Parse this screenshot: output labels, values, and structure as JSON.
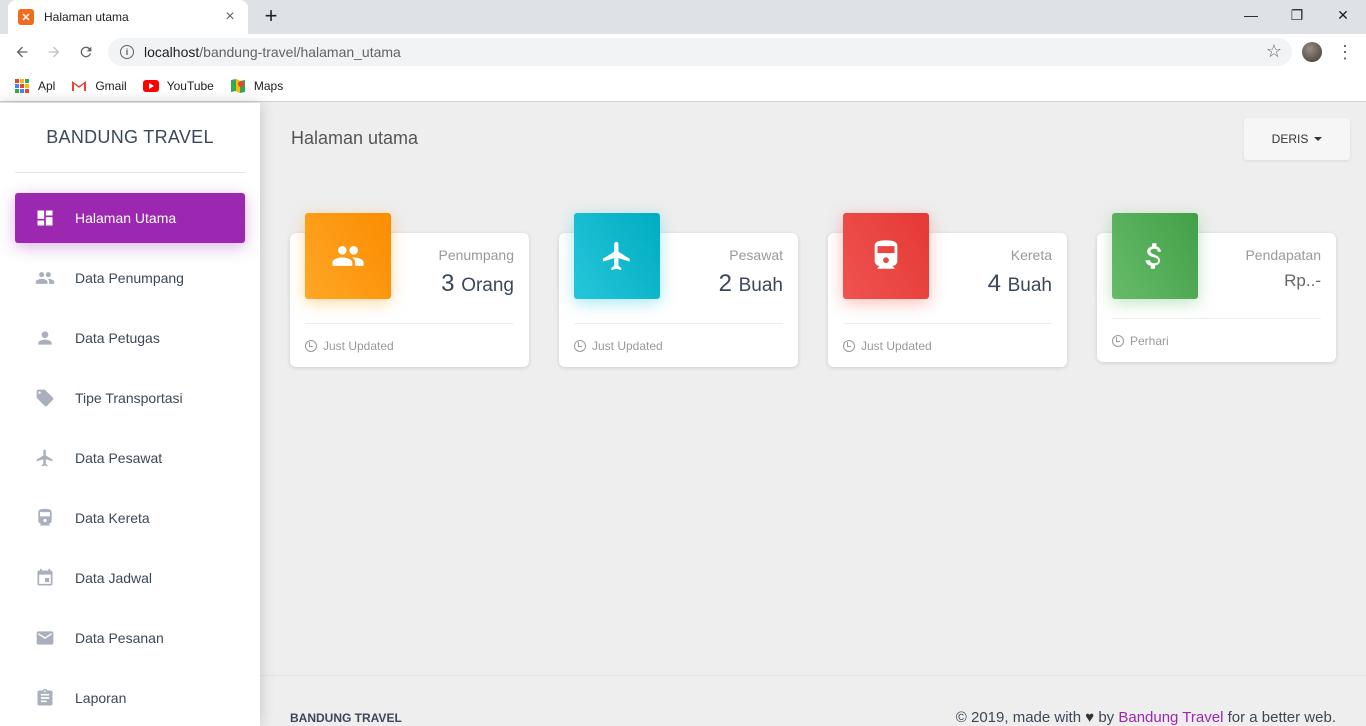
{
  "browser": {
    "tab_title": "Halaman utama",
    "tab_close": "×",
    "new_tab": "+",
    "url_host": "localhost",
    "url_path": "/bandung-travel/halaman_utama",
    "window_controls": {
      "minimize": "—",
      "maximize": "❐",
      "close": "✕"
    },
    "bookmarks": [
      {
        "label": "Apl",
        "icon": "apps-grid-icon"
      },
      {
        "label": "Gmail",
        "icon": "gmail-icon"
      },
      {
        "label": "YouTube",
        "icon": "youtube-icon"
      },
      {
        "label": "Maps",
        "icon": "maps-icon"
      }
    ]
  },
  "sidebar": {
    "brand": "BANDUNG TRAVEL",
    "items": [
      {
        "label": "Halaman Utama",
        "icon": "dashboard-icon",
        "active": true
      },
      {
        "label": "Data Penumpang",
        "icon": "people-icon"
      },
      {
        "label": "Data Petugas",
        "icon": "person-icon"
      },
      {
        "label": "Tipe Transportasi",
        "icon": "tag-icon"
      },
      {
        "label": "Data Pesawat",
        "icon": "airplane-icon"
      },
      {
        "label": "Data Kereta",
        "icon": "train-icon"
      },
      {
        "label": "Data Jadwal",
        "icon": "calendar-icon"
      },
      {
        "label": "Data Pesanan",
        "icon": "mail-icon"
      },
      {
        "label": "Laporan",
        "icon": "assignment-icon"
      }
    ]
  },
  "header": {
    "title": "Halaman utama",
    "user_menu": "DERIS"
  },
  "cards": [
    {
      "category": "Penumpang",
      "number": "3",
      "unit": "Orang",
      "footer": "Just Updated",
      "icon": "people-icon",
      "color_from": "#ffa726",
      "color_to": "#fb8c00"
    },
    {
      "category": "Pesawat",
      "number": "2",
      "unit": "Buah",
      "footer": "Just Updated",
      "icon": "airplane-icon",
      "color_from": "#26c6da",
      "color_to": "#00acc1"
    },
    {
      "category": "Kereta",
      "number": "4",
      "unit": "Buah",
      "footer": "Just Updated",
      "icon": "train-icon",
      "color_from": "#ef5350",
      "color_to": "#e53935"
    },
    {
      "category": "Pendapatan",
      "number": "Rp..-",
      "unit": "",
      "footer": "Perhari",
      "icon": "dollar-icon",
      "color_from": "#66bb6a",
      "color_to": "#43a047"
    }
  ],
  "footer": {
    "brand": "BANDUNG TRAVEL",
    "copyright_prefix": "© 2019, made with",
    "heart": "♥",
    "by": "by",
    "link": "Bandung Travel",
    "suffix": "for a better web."
  },
  "colors": {
    "accent": "#9c27b0",
    "sidebar_icon": "#a9afbb"
  }
}
